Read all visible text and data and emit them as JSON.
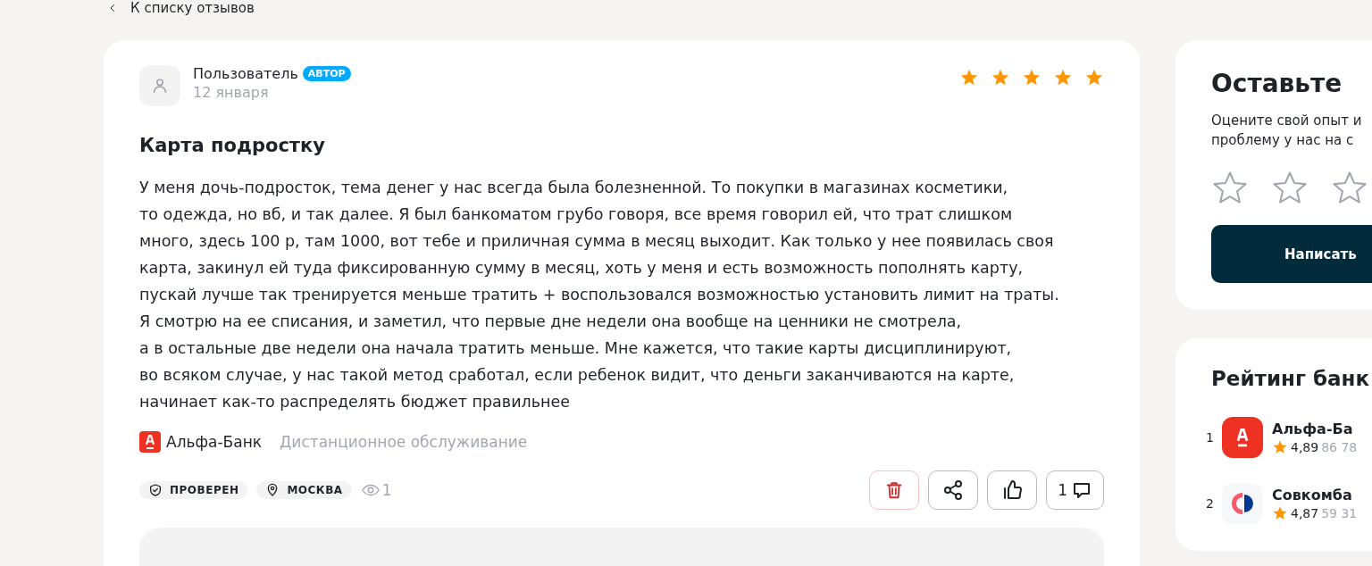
{
  "back_link": "К списку отзывов",
  "review": {
    "author": "Пользователь",
    "author_badge": "АВТОР",
    "date": "12 января",
    "stars": 5,
    "title": "Карта подростку",
    "text": "У меня дочь-подросток, тема денег у нас всегда была болезненной. То покупки в магазинах косметики,\nто одежда, но вб, и так далее. Я был банкоматом грубо говоря, все время говорил ей, что трат слишком\nмного, здесь 100 р, там 1000, вот тебе и приличная сумма в месяц выходит. Как только у нее появилась своя\nкарта, закинул ей туда фиксированную сумму в месяц, хоть у меня и есть возможность пополнять карту,\nпускай лучше так тренируется меньше тратить + воспользовался возможностью установить лимит на траты.\nЯ смотрю на ее списания, и заметил, что первые дне недели она вообще на ценники не смотрела,\nа в остальные две недели она начала тратить меньше. Мне кажется, что такие карты дисциплинируют,\nво всяком случае, у нас такой метод сработал, если ребенок видит, что деньги заканчиваются на карте,\nначинает как-то распределять бюджет правильнее",
    "bank": "Альфа-Банк",
    "category": "Дистанционное обслуживание",
    "tags": [
      {
        "kind": "verified",
        "label": "ПРОВЕРЕН"
      },
      {
        "kind": "location",
        "label": "МОСКВА"
      }
    ],
    "views": "1",
    "actions": [
      {
        "kind": "delete"
      },
      {
        "kind": "share"
      },
      {
        "kind": "like"
      },
      {
        "kind": "comments",
        "count": "1"
      }
    ]
  },
  "sidebar": {
    "cta": {
      "title": "Оставьте",
      "text": "Оцените свой опыт и\nпроблему у нас на с",
      "button": "Написать"
    },
    "rating": {
      "title": "Рейтинг банк",
      "items": [
        {
          "rank": "1",
          "kind": "alfa",
          "name": "Альфа-Ба",
          "score": "4,89",
          "count": "86 78"
        },
        {
          "rank": "2",
          "kind": "sovcom",
          "name": "Совкомба",
          "score": "4,87",
          "count": "59 31"
        }
      ]
    }
  }
}
